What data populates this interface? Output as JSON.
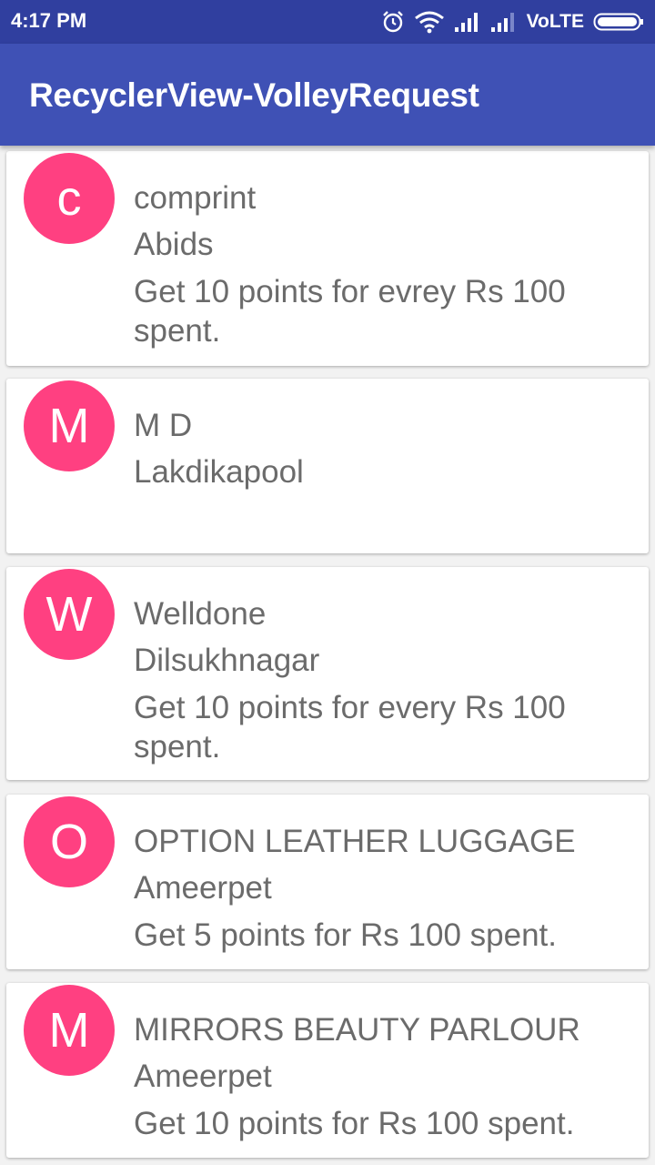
{
  "status_bar": {
    "time": "4:17 PM",
    "network_label": "VoLTE",
    "icons": [
      "alarm-icon",
      "wifi-icon",
      "signal-icon",
      "signal-icon",
      "battery-icon"
    ]
  },
  "app_bar": {
    "title": "RecyclerView-VolleyRequest"
  },
  "colors": {
    "status_bar": "#303f9f",
    "app_bar": "#3f51b5",
    "avatar": "#ff4081",
    "text": "#6b6b6b"
  },
  "items": [
    {
      "initial": "c",
      "name": "comprint",
      "location": "Abids",
      "offer": "Get 10 points for evrey Rs 100 spent."
    },
    {
      "initial": "M",
      "name": "M D",
      "location": "Lakdikapool",
      "offer": ""
    },
    {
      "initial": "W",
      "name": "Welldone",
      "location": "Dilsukhnagar",
      "offer": "Get 10 points for every Rs 100 spent."
    },
    {
      "initial": "O",
      "name": "OPTION LEATHER LUGGAGE",
      "location": "Ameerpet",
      "offer": "Get 5 points for Rs 100 spent."
    },
    {
      "initial": "M",
      "name": "MIRRORS BEAUTY PARLOUR",
      "location": "Ameerpet",
      "offer": "Get 10 points for Rs 100 spent."
    }
  ]
}
